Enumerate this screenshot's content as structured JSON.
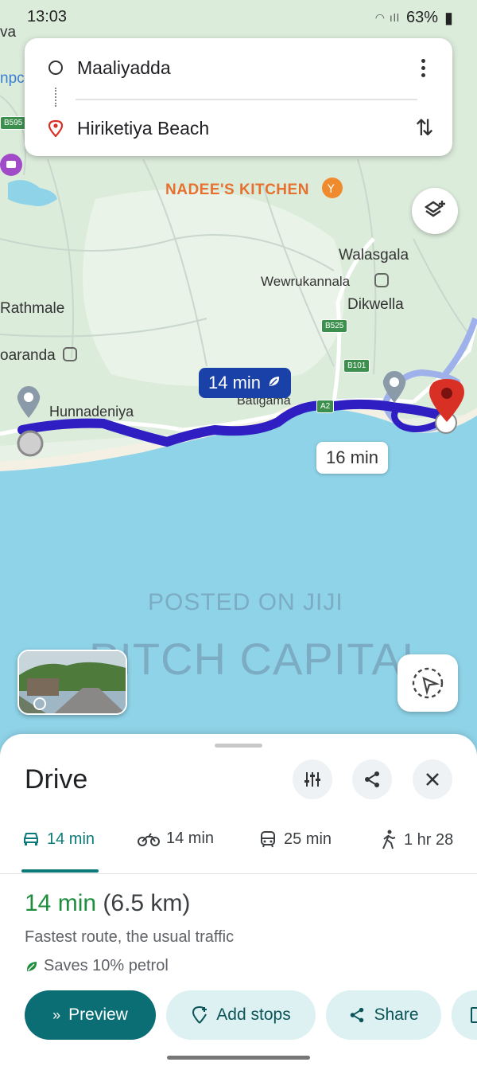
{
  "status_bar": {
    "time": "13:03",
    "battery": "63%"
  },
  "search": {
    "origin": "Maaliyadda",
    "destination": "Hiriketiya Beach"
  },
  "map": {
    "edge_labels": {
      "top_left": "va",
      "left_mid": "npc",
      "road_left": "B595"
    },
    "places": {
      "nadees_kitchen": "NADEE'S KITCHEN",
      "walasgala": "Walasgala",
      "wewrukannala": "Wewrukannala",
      "dikwella": "Dikwella",
      "rathmale": "Rathmale",
      "paranda": "oaranda",
      "hunnadeniya": "Hunnadeniya",
      "batigama": "Batigama"
    },
    "road_badges": {
      "b525": "B525",
      "b101": "B101",
      "a2": "A2"
    },
    "route_primary_time": "14 min",
    "route_alt_time": "16 min",
    "colors": {
      "route": "#2f1fc2",
      "water": "#8fd3e8",
      "land": "#dfeee0",
      "pin": "#d93025"
    }
  },
  "watermark": {
    "line1": "POSTED ON JIJI",
    "line2": "PITCH CAPITAL"
  },
  "sheet": {
    "title": "Drive",
    "modes": [
      {
        "icon": "car-icon",
        "label": "14 min"
      },
      {
        "icon": "motorbike-icon",
        "label": "14 min"
      },
      {
        "icon": "transit-icon",
        "label": "25 min"
      },
      {
        "icon": "walk-icon",
        "label": "1 hr 28"
      }
    ],
    "route": {
      "time": "14 min",
      "distance": "(6.5 km)",
      "description": "Fastest route, the usual traffic",
      "eco": "Saves 10% petrol"
    },
    "actions": {
      "preview": "Preview",
      "add_stops": "Add stops",
      "share": "Share"
    },
    "accent_color": "#0b6e74"
  }
}
